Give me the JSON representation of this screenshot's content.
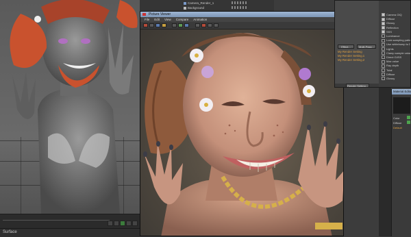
{
  "bottom_bar": {
    "label": "Surface"
  },
  "outliner": {
    "rows": [
      {
        "label": "Camera_Render_1"
      },
      {
        "label": "Background"
      }
    ]
  },
  "picture_viewer": {
    "title": "Picture Viewer",
    "menu": [
      "File",
      "Edit",
      "View",
      "Compare",
      "Animation"
    ]
  },
  "render_settings": {
    "effect_button": "Effect...",
    "multipass_button": "Multi-Pass...",
    "items": [
      "My Render Setting",
      "My Render Setting.1",
      "My Render Setting.2"
    ],
    "bottom_button": "Render Setting...",
    "options": [
      {
        "label": "Camera GIQ",
        "on": true
      },
      {
        "label": "Diffuse",
        "on": true
      },
      {
        "label": "Glossy",
        "on": true
      },
      {
        "label": "Reflection",
        "on": true
      },
      {
        "label": "SSS",
        "on": true
      },
      {
        "label": "Luminance",
        "on": false
      },
      {
        "label": "Lock sampling pattern",
        "on": false
      },
      {
        "label": "Use whitebump to Diffuse",
        "on": false
      },
      {
        "label": "Lights",
        "on": false
      },
      {
        "label": "Clamp sample values",
        "on": false
      },
      {
        "label": "Direct GI/SS",
        "on": false
      },
      {
        "label": "Max value",
        "on": false
      },
      {
        "label": "Ray depth",
        "on": false
      },
      {
        "label": "Total",
        "on": false
      },
      {
        "label": "Diffuse",
        "on": false
      },
      {
        "label": "Glossy",
        "on": false
      }
    ]
  },
  "material_editor": {
    "title": "Material Editor",
    "field1": "Color",
    "field2": "Diffuse",
    "field3": "Default"
  }
}
